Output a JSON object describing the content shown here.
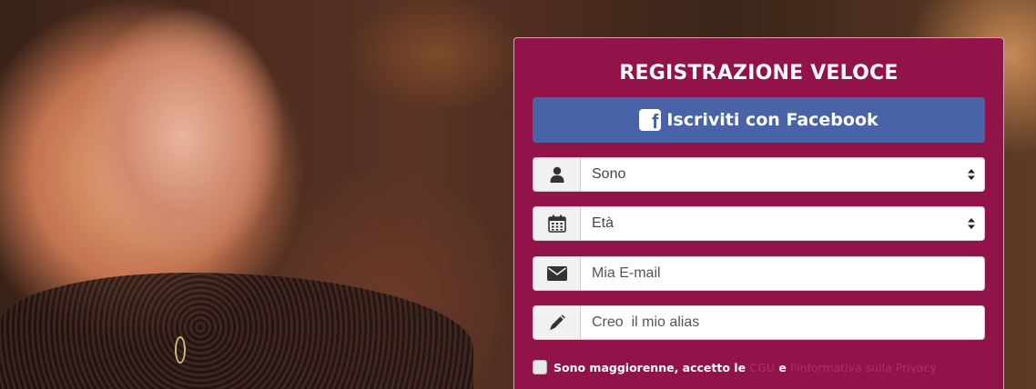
{
  "form": {
    "title": "REGISTRAZIONE VELOCE",
    "facebook_label": "Iscriviti con Facebook",
    "gender": {
      "value": "Sono",
      "icon": "user-icon"
    },
    "age": {
      "value": "Età",
      "icon": "calendar-icon"
    },
    "email": {
      "placeholder": "Mia E-mail",
      "icon": "envelope-icon"
    },
    "alias": {
      "placeholder": "Creo  il mio alias",
      "icon": "pencil-icon"
    },
    "consent": {
      "text_before": "Sono maggiorenne, accetto le",
      "link_cgu": "CGU",
      "conjunction": "e",
      "link_privacy": "l'informativa sulla Privacy"
    }
  },
  "colors": {
    "panel": "#92124a",
    "facebook": "#4863a6",
    "link": "#b02f68"
  }
}
